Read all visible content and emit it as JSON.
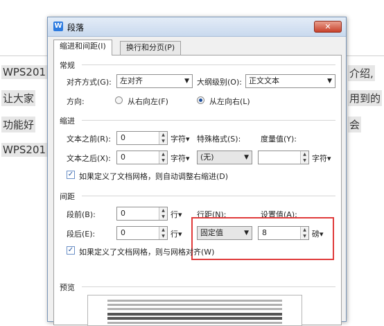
{
  "document": {
    "lines": [
      {
        "left": "WPS201",
        "right": "介绍,"
      },
      {
        "left": "让大家",
        "right": "用到的"
      },
      {
        "left": "功能好",
        "right": "会"
      },
      {
        "left": "WPS201",
        "right": ""
      }
    ]
  },
  "dialog": {
    "title": "段落",
    "icon": "W",
    "close": "✕",
    "tabs": [
      "缩进和间距(I)",
      "换行和分页(P)"
    ],
    "general": {
      "title": "常规",
      "align_label": "对齐方式(G):",
      "align_value": "左对齐",
      "outline_label": "大纲级别(O):",
      "outline_value": "正文文本",
      "direction_label": "方向:",
      "rtl_label": "从右向左(F)",
      "ltr_label": "从左向右(L)"
    },
    "indent": {
      "title": "缩进",
      "before_label": "文本之前(R):",
      "before_value": "0",
      "before_unit": "字符▾",
      "after_label": "文本之后(X):",
      "after_value": "0",
      "after_unit": "字符▾",
      "special_label": "特殊格式(S):",
      "special_value": "(无)",
      "measure_label": "度量值(Y):",
      "measure_value": "",
      "measure_unit": "字符▾",
      "auto_adjust": "如果定义了文档网格，则自动调整右缩进(D)"
    },
    "spacing": {
      "title": "间距",
      "before_label": "段前(B):",
      "before_value": "0",
      "before_unit": "行▾",
      "after_label": "段后(E):",
      "after_value": "0",
      "after_unit": "行▾",
      "line_label": "行距(N):",
      "line_value": "固定值",
      "setting_label": "设置值(A):",
      "setting_value": "8",
      "setting_unit": "磅▾",
      "grid_align": "如果定义了文档网格，则与网格对齐(W)"
    },
    "preview": {
      "title": "预览"
    }
  }
}
